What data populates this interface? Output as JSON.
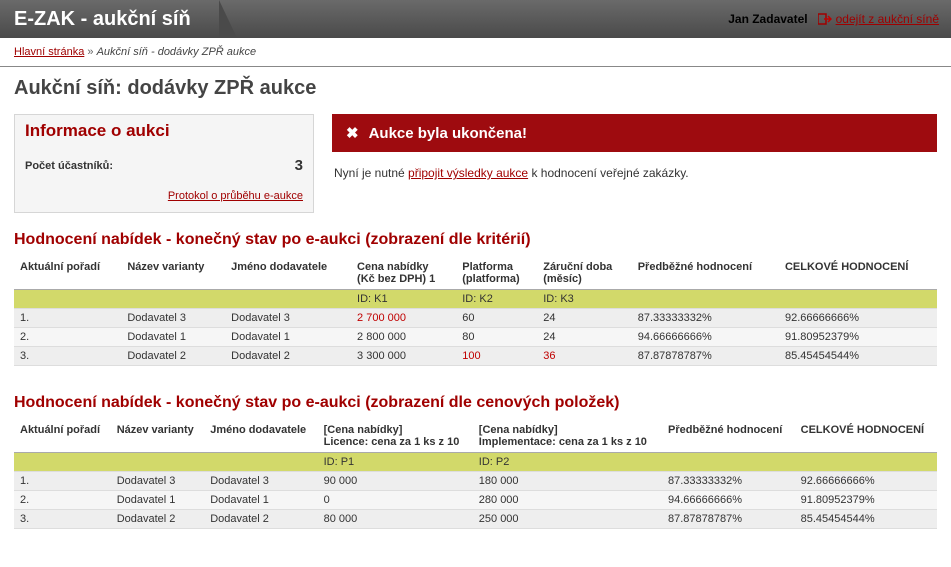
{
  "header": {
    "title": "E-ZAK - aukční síň",
    "username": "Jan Zadavatel",
    "exit_label": "odejít z aukční síně"
  },
  "breadcrumb": {
    "home": "Hlavní stránka",
    "sep": "»",
    "current": "Aukční síň - dodávky ZPŘ aukce"
  },
  "page_title": "Aukční síň: dodávky ZPŘ aukce",
  "info": {
    "heading": "Informace o aukci",
    "participants_label": "Počet účastníků:",
    "participants_value": "3",
    "protocol_link": "Protokol o průběhu e-aukce"
  },
  "alert": {
    "text": "Aukce byla ukončena!"
  },
  "after": {
    "prefix": "Nyní je nutné ",
    "link": "připojit výsledky aukce",
    "suffix": " k hodnocení veřejné zakázky."
  },
  "table1": {
    "heading": "Hodnocení nabídek - konečný stav po e-aukci (zobrazení dle kritérií)",
    "headers": {
      "c0": "Aktuální pořadí",
      "c1": "Název varianty",
      "c2": "Jméno dodavatele",
      "c3a": "Cena nabídky",
      "c3b": "(Kč bez DPH) 1",
      "c4a": "Platforma",
      "c4b": "(platforma)",
      "c5a": "Záruční doba",
      "c5b": "(měsíc)",
      "c6": "Předběžné hodnocení",
      "c7": "CELKOVÉ HODNOCENÍ"
    },
    "idrow": {
      "c3": "ID: K1",
      "c4": "ID: K2",
      "c5": "ID: K3"
    },
    "rows": [
      {
        "c0": "1.",
        "c1": "Dodavatel 3",
        "c2": "Dodavatel 3",
        "c3": "2 700 000",
        "c3_red": true,
        "c4": "60",
        "c5": "24",
        "c6": "87.33333332%",
        "c7": "92.66666666%"
      },
      {
        "c0": "2.",
        "c1": "Dodavatel 1",
        "c2": "Dodavatel 1",
        "c3": "2 800 000",
        "c4": "80",
        "c5": "24",
        "c6": "94.66666666%",
        "c7": "91.80952379%"
      },
      {
        "c0": "3.",
        "c1": "Dodavatel 2",
        "c2": "Dodavatel 2",
        "c3": "3 300 000",
        "c4": "100",
        "c4_red": true,
        "c5": "36",
        "c5_red": true,
        "c6": "87.87878787%",
        "c7": "85.45454544%"
      }
    ]
  },
  "table2": {
    "heading": "Hodnocení nabídek - konečný stav po e-aukci (zobrazení dle cenových položek)",
    "headers": {
      "c0": "Aktuální pořadí",
      "c1": "Název varianty",
      "c2": "Jméno dodavatele",
      "c3a": "[Cena nabídky]",
      "c3b": "Licence: cena za 1 ks z 10",
      "c4a": "[Cena nabídky]",
      "c4b": "Implementace: cena za 1 ks z 10",
      "c5": "Předběžné hodnocení",
      "c6": "CELKOVÉ HODNOCENÍ"
    },
    "idrow": {
      "c3": "ID: P1",
      "c4": "ID: P2"
    },
    "rows": [
      {
        "c0": "1.",
        "c1": "Dodavatel 3",
        "c2": "Dodavatel 3",
        "c3": "90 000",
        "c4": "180 000",
        "c5": "87.33333332%",
        "c6": "92.66666666%"
      },
      {
        "c0": "2.",
        "c1": "Dodavatel 1",
        "c2": "Dodavatel 1",
        "c3": "0",
        "c4": "280 000",
        "c5": "94.66666666%",
        "c6": "91.80952379%"
      },
      {
        "c0": "3.",
        "c1": "Dodavatel 2",
        "c2": "Dodavatel 2",
        "c3": "80 000",
        "c4": "250 000",
        "c5": "87.87878787%",
        "c6": "85.45454544%"
      }
    ]
  }
}
